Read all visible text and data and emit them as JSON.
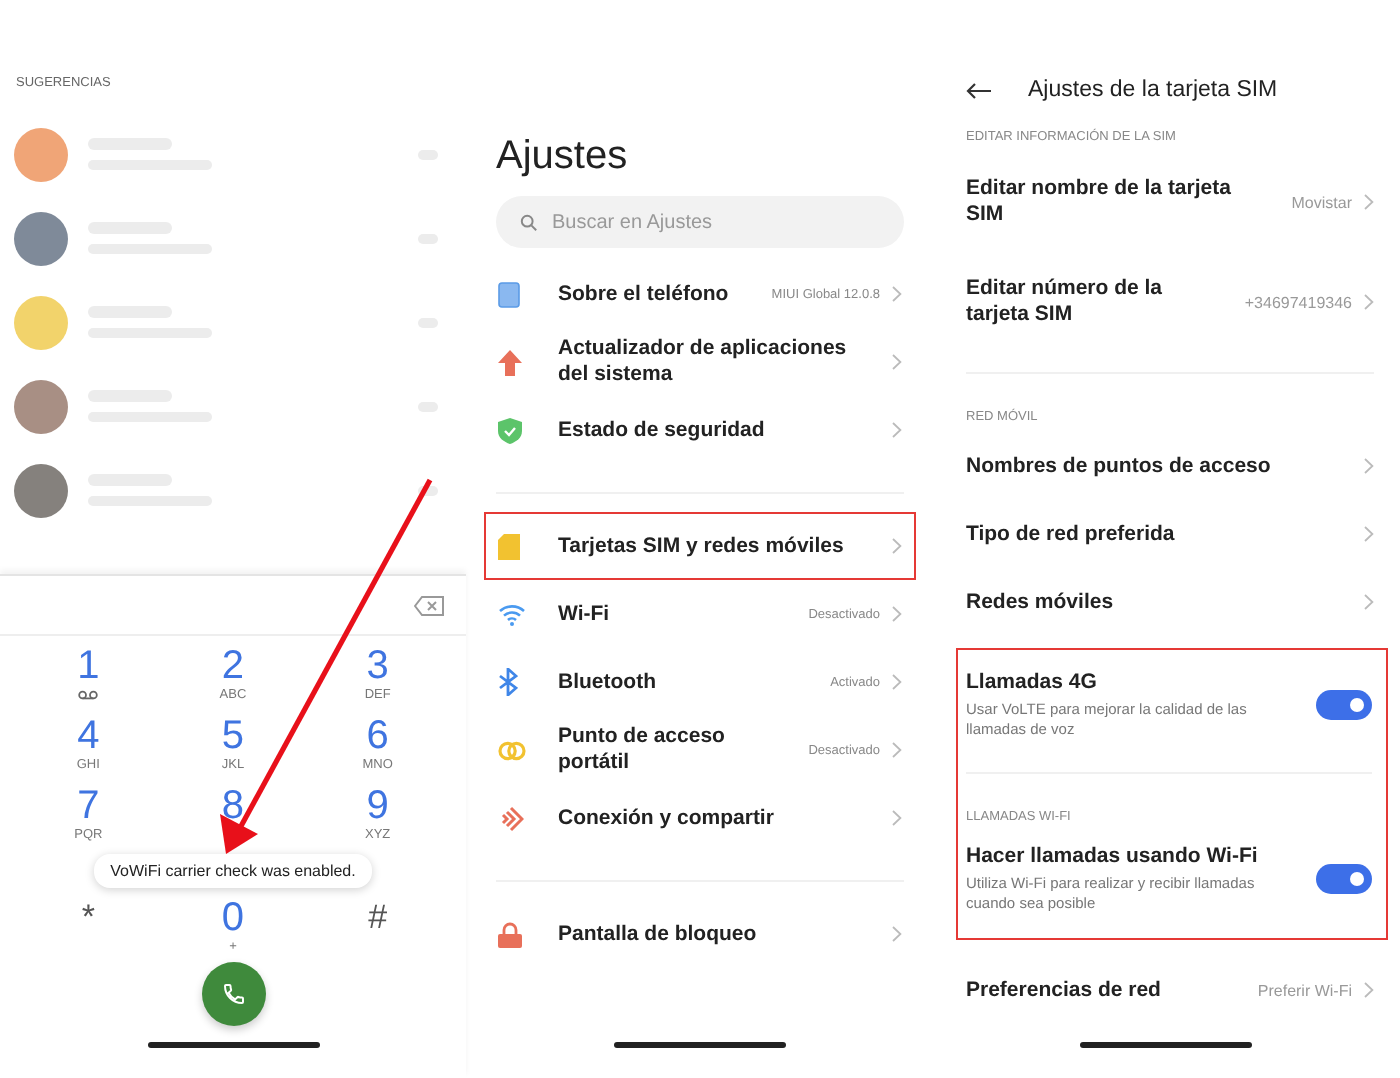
{
  "dialer": {
    "suggestions_heading": "SUGERENCIAS",
    "suggestions": [
      {
        "color": "#f0a577"
      },
      {
        "color": "#7f8a99"
      },
      {
        "color": "#f2d36b"
      },
      {
        "color": "#a88f84"
      },
      {
        "color": "#85817d"
      }
    ],
    "keys": [
      {
        "kind": "voicemail",
        "digit": "1"
      },
      {
        "kind": "letters",
        "digit": "2",
        "letters": "ABC"
      },
      {
        "kind": "letters",
        "digit": "3",
        "letters": "DEF"
      },
      {
        "kind": "letters",
        "digit": "4",
        "letters": "GHI"
      },
      {
        "kind": "letters",
        "digit": "5",
        "letters": "JKL"
      },
      {
        "kind": "letters",
        "digit": "6",
        "letters": "MNO"
      },
      {
        "kind": "letters",
        "digit": "7",
        "letters": "PQR"
      },
      {
        "kind": "plain",
        "digit": "8"
      },
      {
        "kind": "letters",
        "digit": "9",
        "letters": "XYZ"
      },
      {
        "kind": "symbol",
        "digit": "*"
      },
      {
        "kind": "letters",
        "digit": "0",
        "letters": "+"
      },
      {
        "kind": "symbol",
        "digit": "#"
      }
    ],
    "toast": "VoWiFi carrier check was enabled."
  },
  "settings": {
    "title": "Ajustes",
    "search": {
      "placeholder": "Buscar en Ajustes"
    },
    "groups": [
      {
        "items": [
          {
            "kind": "phone",
            "label": "Sobre el teléfono",
            "value": "MIUI Global 12.0.8",
            "highlighted": false
          },
          {
            "kind": "update",
            "label": "Actualizador de aplicaciones del sistema",
            "highlighted": false
          },
          {
            "kind": "security",
            "label": "Estado de seguridad",
            "highlighted": false
          }
        ]
      },
      {
        "items": [
          {
            "kind": "sim",
            "label": "Tarjetas SIM y redes móviles",
            "highlighted": true
          },
          {
            "kind": "wifi",
            "label": "Wi-Fi",
            "value": "Desactivado",
            "highlighted": false
          },
          {
            "kind": "bluetooth",
            "label": "Bluetooth",
            "value": "Activado",
            "highlighted": false
          },
          {
            "kind": "hotspot",
            "label": "Punto de acceso portátil",
            "value": "Desactivado",
            "highlighted": false
          },
          {
            "kind": "connection",
            "label": "Conexión y compartir",
            "highlighted": false
          }
        ]
      },
      {
        "items": [
          {
            "kind": "lock",
            "label": "Pantalla de bloqueo",
            "highlighted": false
          }
        ]
      }
    ]
  },
  "sim_settings": {
    "title": "Ajustes de la tarjeta SIM",
    "groups": [
      {
        "highlighted": false,
        "sections": [
          {
            "heading": "EDITAR INFORMACIÓN DE LA SIM",
            "items": [
              {
                "kind": "link",
                "label": "Editar nombre de la tarjeta SIM",
                "value": "Movistar"
              },
              {
                "kind": "link",
                "label": "Editar número de la tarjeta SIM",
                "value": "+34697419346"
              }
            ]
          },
          {
            "heading": "RED MÓVIL",
            "items": [
              {
                "kind": "link",
                "label": "Nombres de puntos de acceso"
              },
              {
                "kind": "link",
                "label": "Tipo de red preferida"
              },
              {
                "kind": "link",
                "label": "Redes móviles"
              }
            ]
          }
        ]
      },
      {
        "highlighted": true,
        "sections": [
          {
            "items": [
              {
                "kind": "toggle",
                "label": "Llamadas 4G",
                "description": "Usar VoLTE para mejorar la calidad de las llamadas de voz",
                "on": true
              }
            ]
          },
          {
            "heading": "LLAMADAS WI-FI",
            "items": [
              {
                "kind": "toggle",
                "label": "Hacer llamadas usando Wi-Fi",
                "description": "Utiliza Wi-Fi para realizar y recibir llamadas cuando sea posible",
                "on": true
              }
            ]
          }
        ]
      },
      {
        "highlighted": false,
        "sections": [
          {
            "items": [
              {
                "kind": "link",
                "label": "Preferencias de red",
                "value": "Preferir Wi-Fi"
              }
            ]
          }
        ]
      }
    ]
  }
}
